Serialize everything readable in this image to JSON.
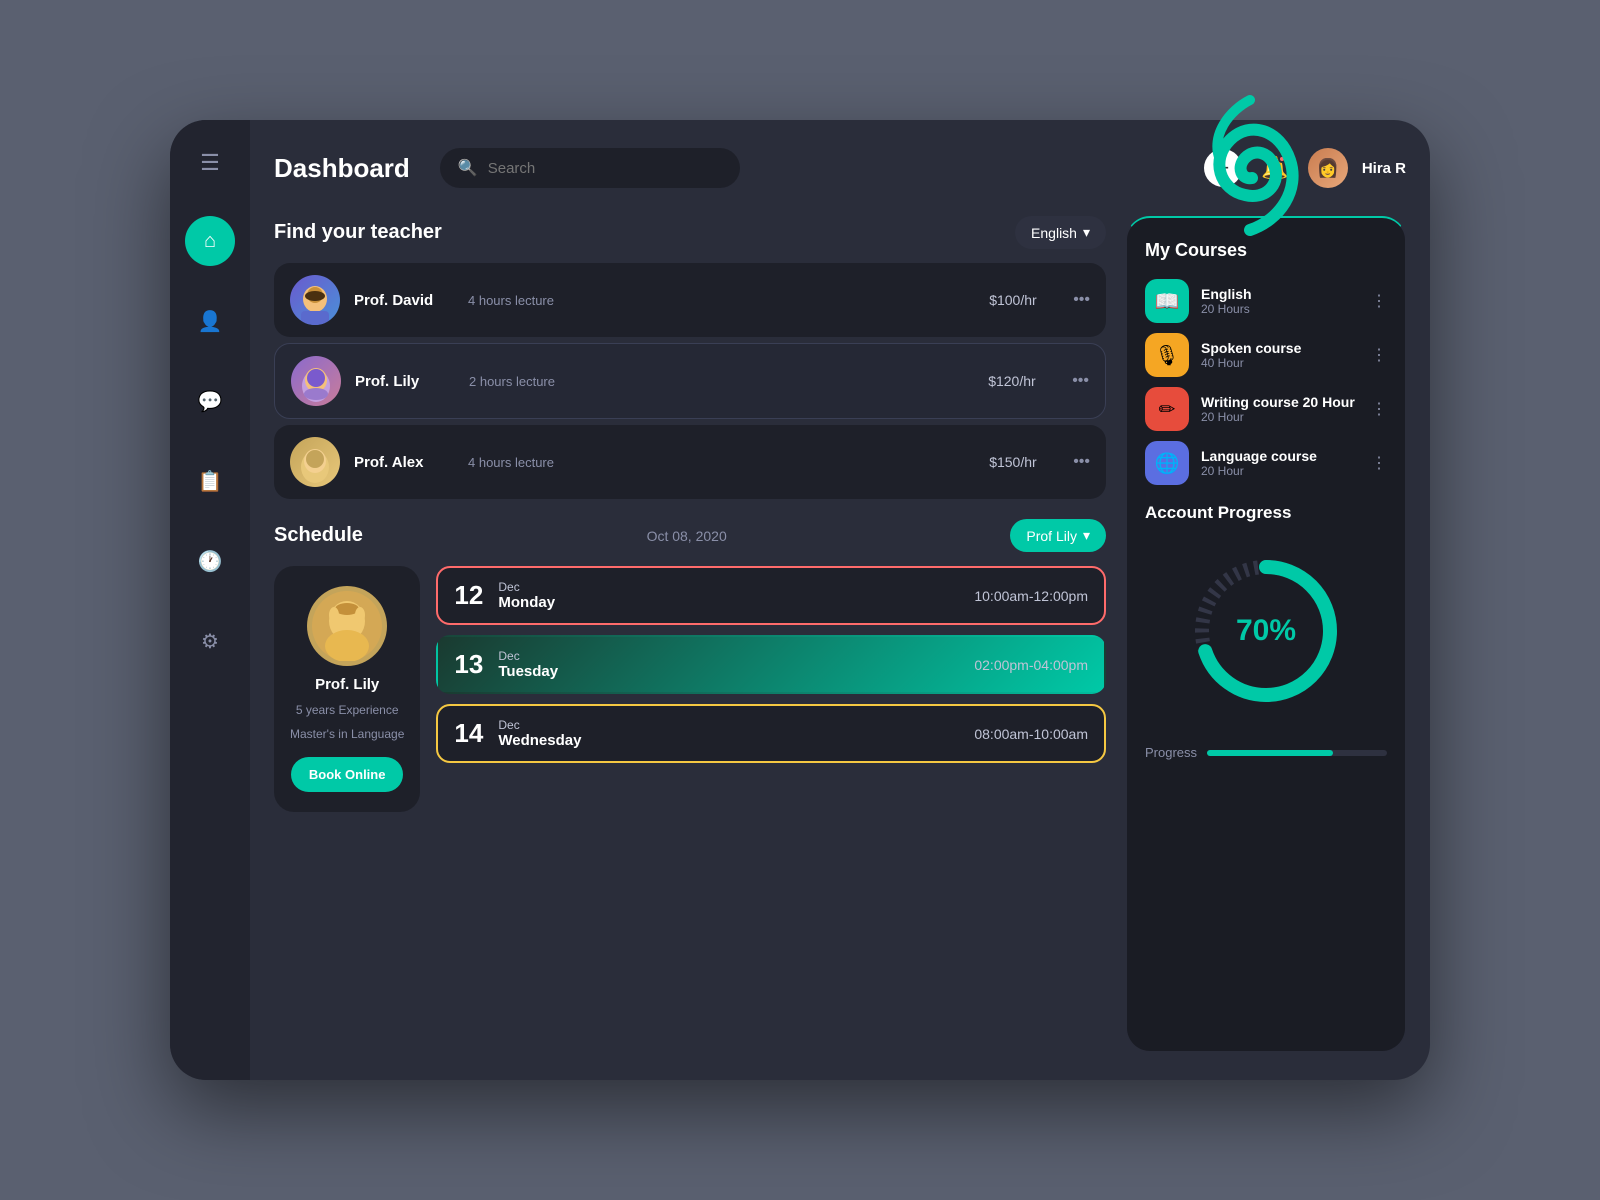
{
  "header": {
    "title": "Dashboard",
    "search_placeholder": "Search",
    "user_name": "Hira R"
  },
  "sidebar": {
    "items": [
      {
        "label": "menu",
        "icon": "☰",
        "active": false
      },
      {
        "label": "home",
        "icon": "⌂",
        "active": true
      },
      {
        "label": "user",
        "icon": "👤",
        "active": false
      },
      {
        "label": "chat",
        "icon": "💬",
        "active": false
      },
      {
        "label": "calendar",
        "icon": "📋",
        "active": false
      },
      {
        "label": "clock",
        "icon": "🕐",
        "active": false
      },
      {
        "label": "settings",
        "icon": "⚙",
        "active": false
      }
    ]
  },
  "find_teacher": {
    "title": "Find your teacher",
    "filter": "English",
    "teachers": [
      {
        "name": "Prof. David",
        "lecture": "4 hours lecture",
        "rate": "$100/hr"
      },
      {
        "name": "Prof. Lily",
        "lecture": "2 hours lecture",
        "rate": "$120/hr"
      },
      {
        "name": "Prof. Alex",
        "lecture": "4 hours lecture",
        "rate": "$150/hr"
      }
    ]
  },
  "schedule": {
    "title": "Schedule",
    "date": "Oct 08, 2020",
    "filter": "Prof Lily",
    "profile": {
      "name": "Prof. Lily",
      "experience": "5 years Experience",
      "degree": "Master's in Language",
      "book_label": "Book Online"
    },
    "slots": [
      {
        "day": "12",
        "month": "Dec",
        "dayname": "Monday",
        "time": "10:00am-12:00pm",
        "style": "red"
      },
      {
        "day": "13",
        "month": "Dec",
        "dayname": "Tuesday",
        "time": "02:00pm-04:00pm",
        "style": "green"
      },
      {
        "day": "14",
        "month": "Dec",
        "dayname": "Wednesday",
        "time": "08:00am-10:00am",
        "style": "yellow"
      }
    ]
  },
  "my_courses": {
    "title": "My Courses",
    "courses": [
      {
        "name": "English",
        "duration": "20 Hours",
        "icon": "📖",
        "color": "teal"
      },
      {
        "name": "Spoken course",
        "duration": "40 Hour",
        "icon": "🎙",
        "color": "orange"
      },
      {
        "name": "Writing course 20 Hour",
        "duration": "20 Hour",
        "icon": "✏",
        "color": "red"
      },
      {
        "name": "Language course",
        "duration": "20 Hour",
        "icon": "🌐",
        "color": "blue"
      }
    ]
  },
  "account_progress": {
    "title": "Account Progress",
    "percent": "70%",
    "percent_value": 70,
    "label": "Progress"
  }
}
